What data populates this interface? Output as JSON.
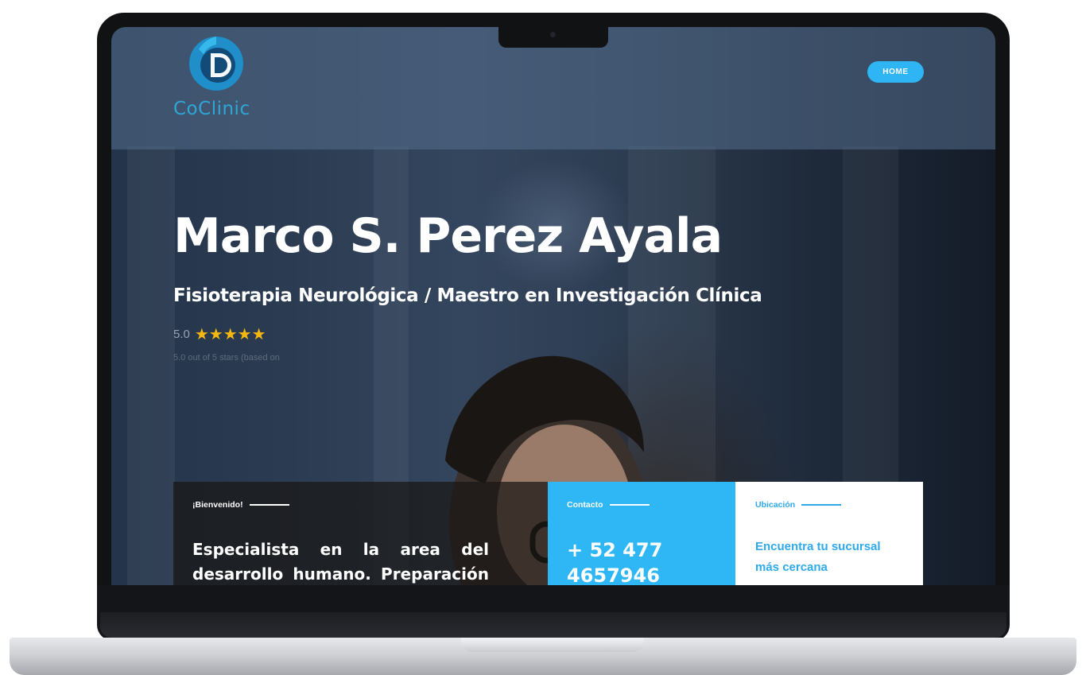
{
  "header": {
    "logo_text": "CoClinic",
    "logo_icon": "coclinic-logo-icon",
    "nav": [
      {
        "label": "HOME"
      }
    ]
  },
  "hero": {
    "name": "Marco S. Perez Ayala",
    "subtitle": "Fisioterapia Neurológica / Maestro en Investigación Clínica",
    "rating_value": "5.0",
    "stars": 5,
    "rating_caption": "5.0 out of 5 stars (based on"
  },
  "cards": {
    "welcome": {
      "label": "¡Bienvenido!",
      "text": "Especialista en la area del desarrollo humano. Preparación"
    },
    "contact": {
      "label": "Contacto",
      "phone": "+ 52 477 4657946"
    },
    "location": {
      "label": "Ubicación",
      "text": "Encuentra tu sucursal más cercana"
    }
  },
  "colors": {
    "accent": "#2fb4f4",
    "star": "#f5b70e",
    "logo": "#1f8ec9",
    "location_text": "#2fa9ea"
  }
}
